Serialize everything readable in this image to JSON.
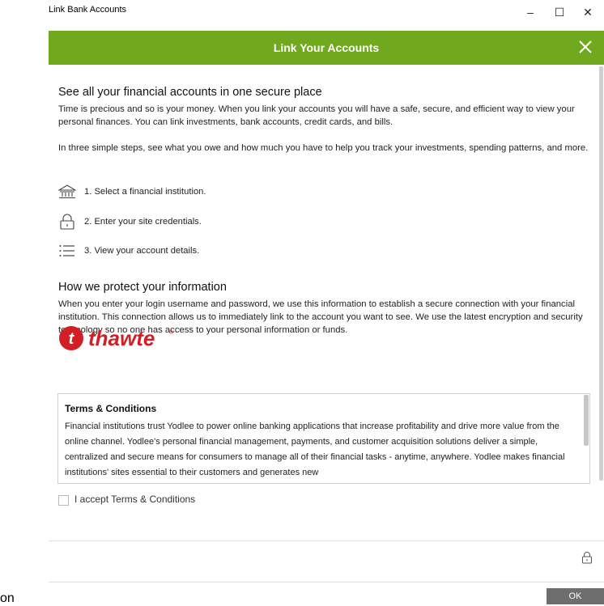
{
  "window": {
    "title": "Link Bank Accounts",
    "minimize_glyph": "–",
    "maximize_glyph": "☐",
    "close_glyph": "✕"
  },
  "dialog": {
    "header_title": "Link Your Accounts",
    "close_icon": "close-icon",
    "accent_color": "#71a91e"
  },
  "section1": {
    "heading": "See all your financial accounts in one secure place",
    "para1": "Time is precious and so is your money. When you link your accounts you will have a safe, secure, and efficient way to view your personal finances. You can link investments, bank accounts, credit cards, and bills.",
    "para2": "In three simple steps, see what you owe and how much you have to help you track your investments, spending patterns, and more."
  },
  "steps": [
    {
      "icon": "bank-icon",
      "label": "1. Select a financial institution."
    },
    {
      "icon": "lock-icon",
      "label": "2. Enter your site credentials."
    },
    {
      "icon": "list-icon",
      "label": "3. View your account details."
    }
  ],
  "section2": {
    "heading": "How we protect your information",
    "para": "When you enter your login username and password, we use this information to establish a secure connection with your financial institution. This connection allows us to immediately link to the account you want to see. We use the latest encryption and security technology so no one has access to your personal information or funds."
  },
  "logo": {
    "text": "thawte",
    "mark": "t",
    "registered": "®",
    "color": "#d21f26"
  },
  "terms": {
    "title": "Terms & Conditions",
    "body": "Financial institutions trust Yodlee to power online banking applications that increase profitability and drive more value from the online channel. Yodlee's personal financial management, payments, and customer acquisition solutions deliver a simple, centralized and secure means for consumers to manage all of their financial tasks - anytime, anywhere. Yodlee makes financial institutions' sites essential to their customers and generates new"
  },
  "accept_label": "I accept Terms & Conditions",
  "footer": {
    "lock_icon": "lock-icon",
    "ok_label": "OK",
    "left_text": "on"
  }
}
